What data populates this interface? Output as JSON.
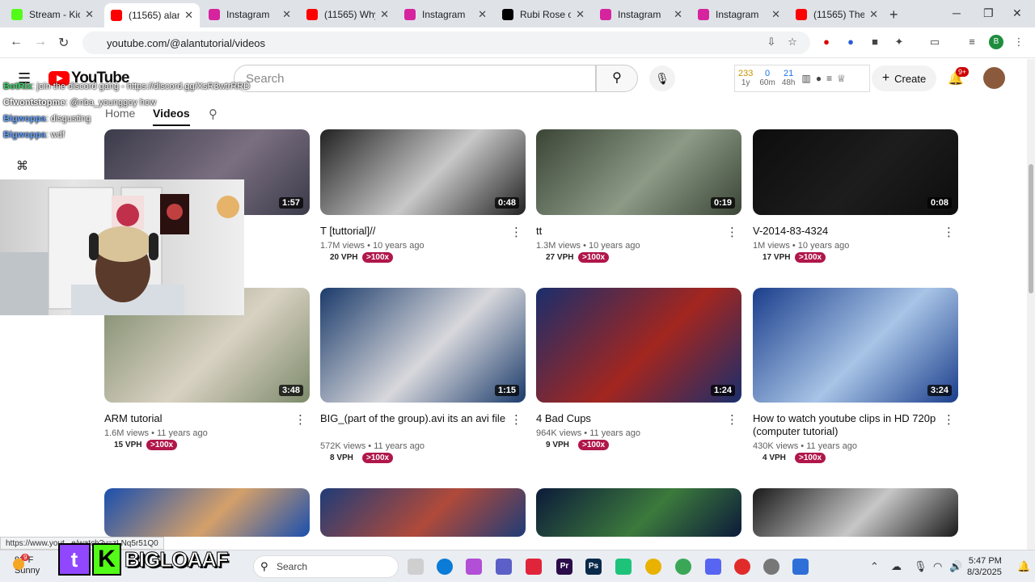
{
  "tabs": [
    {
      "title": "Stream - Kick",
      "favicon": "kick-icon",
      "color": "#53fc18"
    },
    {
      "title": "(11565) alantu",
      "favicon": "youtube-icon",
      "color": "#ff0000",
      "active": true
    },
    {
      "title": "Instagram",
      "favicon": "instagram-icon",
      "color": "#d6249f"
    },
    {
      "title": "(11565) Why",
      "favicon": "youtube-icon",
      "color": "#ff0000"
    },
    {
      "title": "Instagram",
      "favicon": "instagram-icon",
      "color": "#d6249f"
    },
    {
      "title": "Rubi Rose on",
      "favicon": "x-icon",
      "color": "#000000"
    },
    {
      "title": "Instagram",
      "favicon": "instagram-icon",
      "color": "#d6249f"
    },
    {
      "title": "Instagram",
      "favicon": "instagram-icon",
      "color": "#d6249f"
    },
    {
      "title": "(11565) The J",
      "favicon": "youtube-icon",
      "color": "#ff0000"
    }
  ],
  "address": {
    "url": "youtube.com/@alantutorial/videos"
  },
  "yt": {
    "logo": "YouTube",
    "search_placeholder": "Search",
    "create": "Create",
    "notif_count": "9+",
    "stats": [
      {
        "value": "233",
        "label": "1y"
      },
      {
        "value": "0",
        "label": "60m"
      },
      {
        "value": "21",
        "label": "48h"
      }
    ]
  },
  "channel_tabs": {
    "home": "Home",
    "videos": "Videos"
  },
  "chat": [
    {
      "user": "BotRix",
      "msg": ": join the discord gang - https://discord.gg/XsR3wtrRRD"
    },
    {
      "user": "Cfwontstopme",
      "msg": ": @nba_younggoy how"
    },
    {
      "user": "Bigwoppa",
      "msg": ": disgusting"
    },
    {
      "user": "Bigwoppa",
      "msg": ": wdf"
    }
  ],
  "videos": [
    {
      "title": "",
      "duration": "1:57",
      "meta": "",
      "vph": "",
      "ratio": "",
      "colors": [
        "#3b3b4a",
        "#7a6f80"
      ]
    },
    {
      "title": "T [tuttorial]//",
      "duration": "0:48",
      "meta": "1.7M views • 10 years ago",
      "vph": "20 VPH",
      "ratio": ">100x",
      "colors": [
        "#222",
        "#c8c8c8"
      ]
    },
    {
      "title": "tt",
      "duration": "0:19",
      "meta": "1.3M views • 10 years ago",
      "vph": "27 VPH",
      "ratio": ">100x",
      "colors": [
        "#3b4536",
        "#8c9a86"
      ]
    },
    {
      "title": "V-2014-83-4324",
      "duration": "0:08",
      "meta": "1M views • 10 years ago",
      "vph": "17 VPH",
      "ratio": ">100x",
      "colors": [
        "#0d0d0d",
        "#1d1d1d"
      ]
    },
    {
      "title": "ARM tutorial",
      "duration": "3:48",
      "meta": "1.6M views • 11 years ago",
      "vph": "15 VPH",
      "ratio": ">100x",
      "colors": [
        "#7d8a6b",
        "#d9d2c3"
      ]
    },
    {
      "title": "BIG_(part of the group).avi its an avi file",
      "duration": "1:15",
      "meta": "572K views • 11 years ago",
      "vph": "8 VPH",
      "ratio": ">100x",
      "colors": [
        "#1b3b6b",
        "#d8d8dc"
      ]
    },
    {
      "title": "4 Bad Cups",
      "duration": "1:24",
      "meta": "964K views • 11 years ago",
      "vph": "9 VPH",
      "ratio": ">100x",
      "colors": [
        "#1a2e6c",
        "#a3261f"
      ]
    },
    {
      "title": "How to watch youtube clips in HD 720p (computer tutorial)",
      "duration": "3:24",
      "meta": "430K views • 11 years ago",
      "vph": "4 VPH",
      "ratio": ">100x",
      "colors": [
        "#1b3e8c",
        "#a8c4e6"
      ]
    },
    {
      "title": "",
      "duration": "",
      "meta": "",
      "vph": "",
      "ratio": "",
      "colors": [
        "#1a4fae",
        "#d4a06a"
      ]
    },
    {
      "title": "",
      "duration": "",
      "meta": "",
      "vph": "",
      "ratio": "",
      "colors": [
        "#1f3c78",
        "#b04a3a"
      ]
    },
    {
      "title": "",
      "duration": "",
      "meta": "",
      "vph": "",
      "ratio": "",
      "colors": [
        "#0c1a3a",
        "#3c7a3c"
      ]
    },
    {
      "title": "",
      "duration": "",
      "meta": "",
      "vph": "",
      "ratio": "",
      "colors": [
        "#1a1a1a",
        "#c7c7c7"
      ]
    }
  ],
  "status_url": "https://www.yout...e/watch?v=zLNq5r51Q0",
  "overlay_brand": "BIGLOAAF",
  "taskbar": {
    "weather_temp": "92°F",
    "weather_desc": "Sunny",
    "weather_badge": "9",
    "search": "Search",
    "time": "5:47 PM",
    "date": "8/3/2025"
  }
}
